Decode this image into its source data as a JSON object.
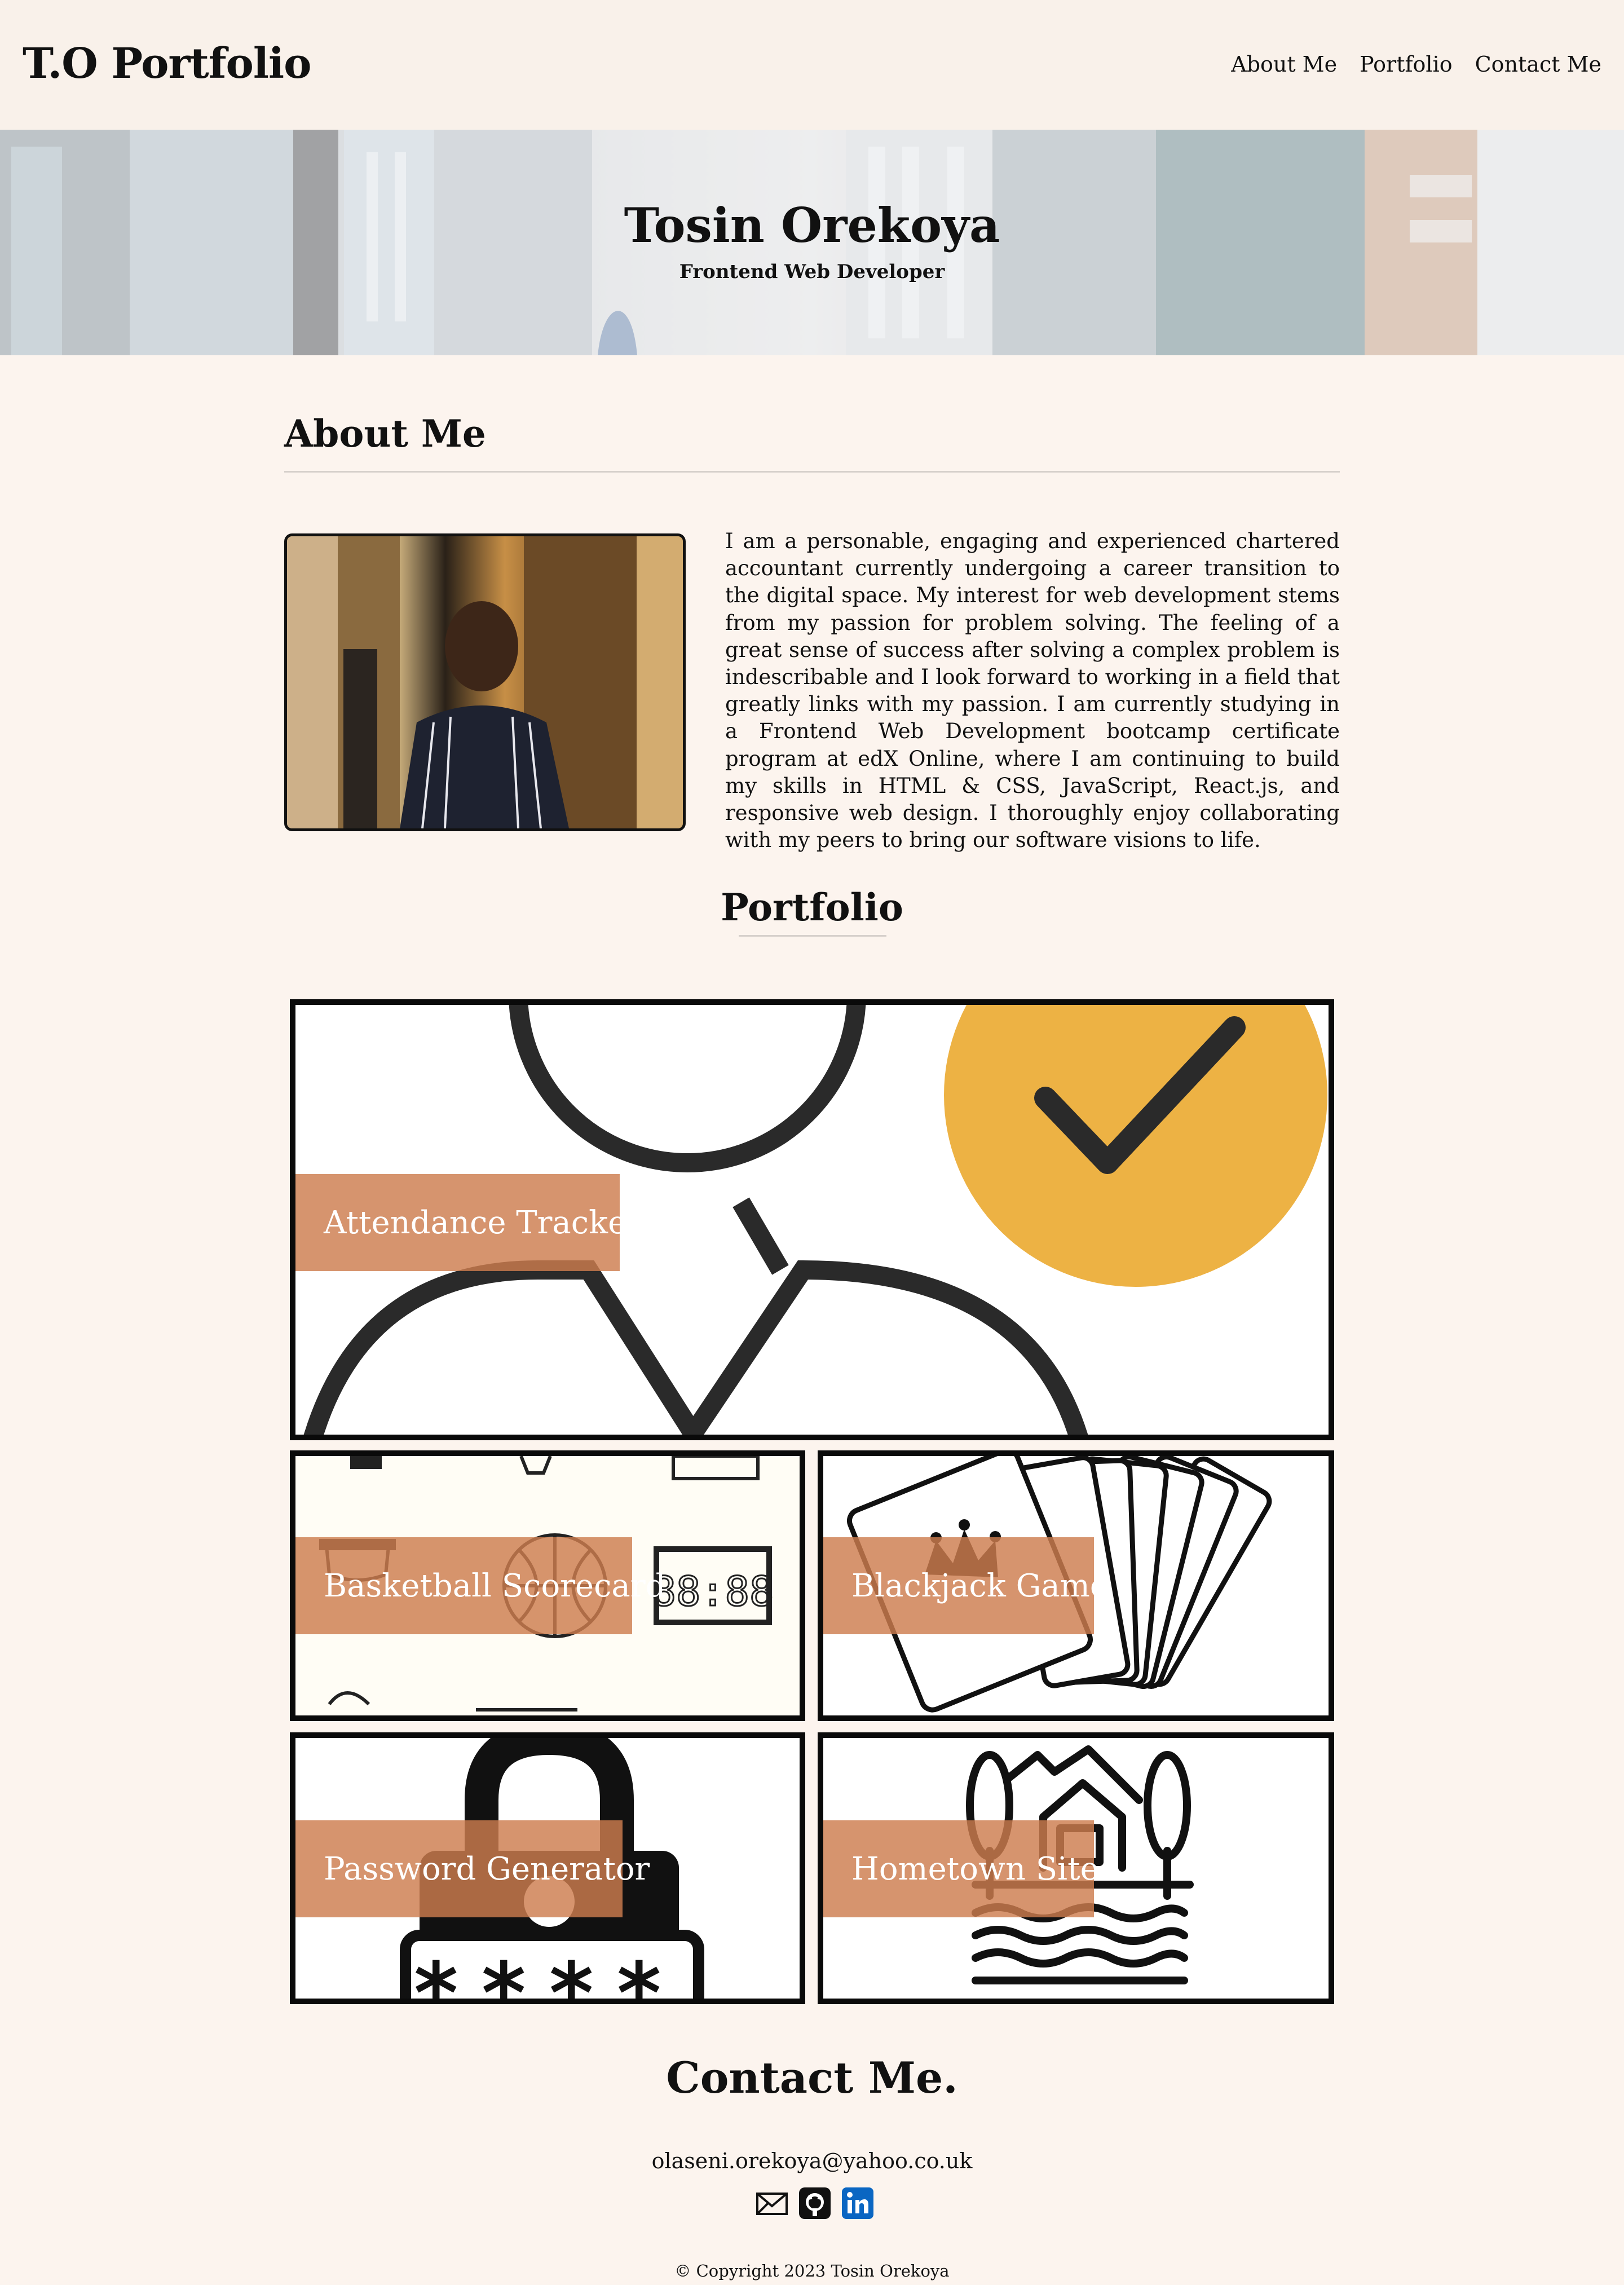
{
  "header": {
    "brand": "T.O Portfolio",
    "nav": [
      "About Me",
      "Portfolio",
      "Contact Me"
    ]
  },
  "hero": {
    "name": "Tosin Orekoya",
    "role": "Frontend Web Developer"
  },
  "about": {
    "title": "About Me",
    "text": "I am a personable, engaging and experienced chartered accountant currently undergoing a career transition to the digital space. My interest for web development stems from my passion for problem solving. The feeling of a great sense of success after solving a complex problem is indescribable and I look forward to working in a field that greatly links with my passion. I am currently studying in a Frontend Web Development bootcamp certificate program at edX Online, where I am continuing to build my skills in HTML & CSS, JavaScript, React.js, and responsive web design. I thoroughly enjoy collaborating with my peers to bring our software visions to life."
  },
  "portfolio": {
    "title": "Portfolio",
    "projects": [
      {
        "label": "Attendance Tracker",
        "icon": "attendance-icon"
      },
      {
        "label": "Basketball Scorecard",
        "icon": "basketball-icon"
      },
      {
        "label": "Blackjack Game",
        "icon": "playing-cards-icon"
      },
      {
        "label": "Password Generator",
        "icon": "padlock-icon"
      },
      {
        "label": "Hometown Site",
        "icon": "house-icon"
      }
    ],
    "scoreboard_digits": "88:88"
  },
  "contact": {
    "title": "Contact Me.",
    "email": "olaseni.orekoya@yahoo.co.uk",
    "icons": [
      "mail-icon",
      "github-icon",
      "linkedin-icon"
    ]
  },
  "footer": {
    "copyright": "© Copyright 2023 Tosin Orekoya"
  },
  "colors": {
    "background": "#fcf4ee",
    "label_overlay": "#cd7c4e",
    "accent_yellow": "#edb244",
    "linkedin_blue": "#0a66c2"
  }
}
